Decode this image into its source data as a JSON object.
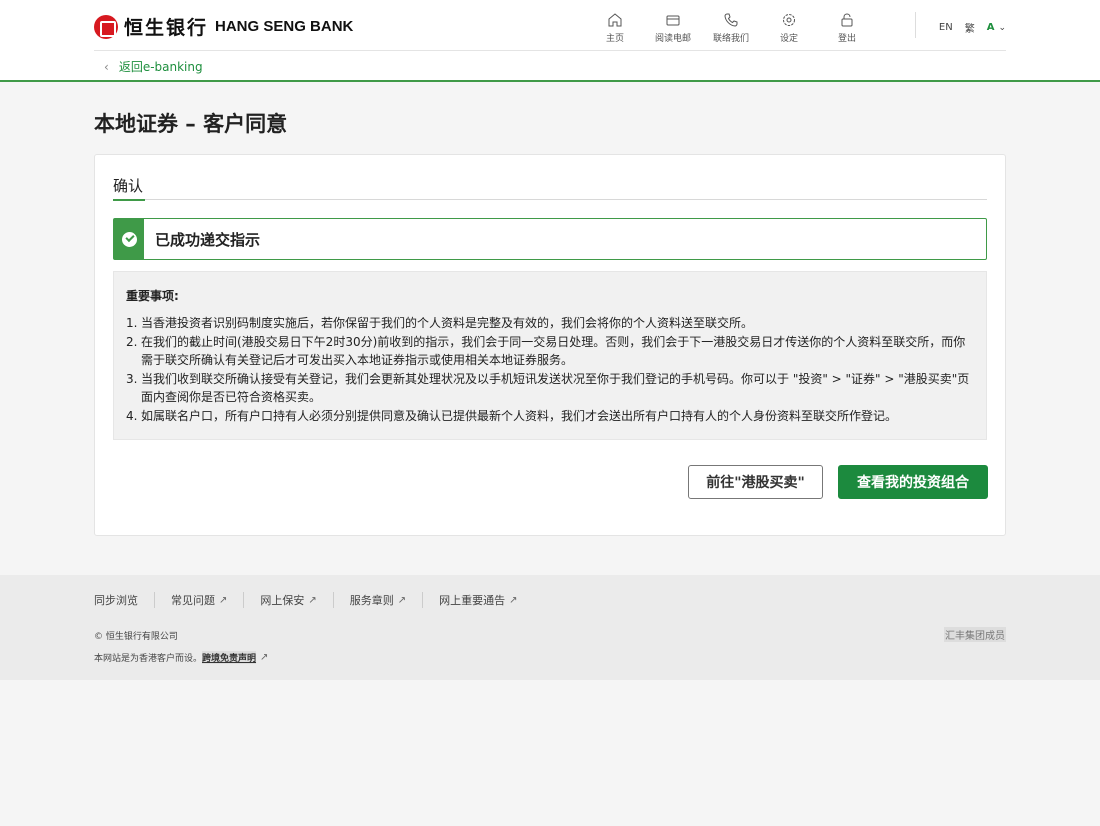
{
  "header": {
    "logo_cn": "恒生银行",
    "logo_en": "HANG SENG BANK",
    "nav": [
      {
        "label": "主页",
        "icon": "home-icon"
      },
      {
        "label": "阅读电邮",
        "icon": "mail-icon"
      },
      {
        "label": "联络我们",
        "icon": "phone-icon"
      },
      {
        "label": "设定",
        "icon": "gear-icon"
      },
      {
        "label": "登出",
        "icon": "lock-icon"
      }
    ],
    "lang_en": "EN",
    "lang_tc": "繁",
    "font_size": "A"
  },
  "back_link": "返回e-banking",
  "page_title": "本地证券 – 客户同意",
  "card": {
    "tab": "确认",
    "success": "已成功递交指示",
    "notice_title": "重要事项:",
    "notices": [
      {
        "num": "1.",
        "text": "当香港投资者识别码制度实施后，若你保留于我们的个人资料是完整及有效的，我们会将你的个人资料送至联交所。"
      },
      {
        "num": "2.",
        "text": "在我们的截止时间(港股交易日下午2时30分)前收到的指示，我们会于同一交易日处理。否则，我们会于下一港股交易日才传送你的个人资料至联交所，而你需于联交所确认有关登记后才可发出买入本地证券指示或使用相关本地证券服务。"
      },
      {
        "num": "3.",
        "text": "当我们收到联交所确认接受有关登记，我们会更新其处理状况及以手机短讯发送状况至你于我们登记的手机号码。你可以于 \"投资\" > \"证券\" > \"港股买卖\"页面内查阅你是否已符合资格买卖。"
      },
      {
        "num": "4.",
        "text": "如属联名户口，所有户口持有人必须分别提供同意及确认已提供最新个人资料，我们才会送出所有户口持有人的个人身份资料至联交所作登记。"
      }
    ],
    "btn_secondary": "前往\"港股买卖\"",
    "btn_primary": "查看我的投资组合"
  },
  "footer": {
    "links": [
      {
        "label": "同步浏览",
        "external": false
      },
      {
        "label": "常见问题",
        "external": true
      },
      {
        "label": "网上保安",
        "external": true
      },
      {
        "label": "服务章则",
        "external": true
      },
      {
        "label": "网上重要通告",
        "external": true
      }
    ],
    "copyright": "© 恒生银行有限公司",
    "disclaimer_prefix": "本网站是为香港客户而设。",
    "disclaimer_link": "跨境免责声明",
    "group": "汇丰集团成员"
  },
  "colors": {
    "brand_green": "#1c8a3e",
    "accent_green": "#3f9a48",
    "logo_red": "#d71920"
  }
}
